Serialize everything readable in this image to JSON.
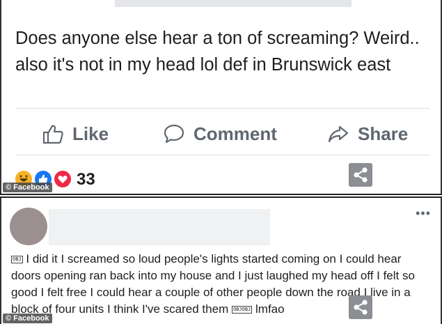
{
  "post": {
    "text": "Does anyone else hear a ton of screaming? Weird.. also it's not in my head lol def in Brunswick east",
    "actions": {
      "like": "Like",
      "comment": "Comment",
      "share": "Share"
    },
    "reaction_count": "33",
    "reaction_icons": [
      "haha-icon",
      "like-icon",
      "love-icon"
    ]
  },
  "watermark": "© Facebook",
  "reply": {
    "menu_label": "•••",
    "text_prefix_glyph": "OBJ",
    "text": "I did it I screamed so loud people's lights started coming on I could hear doors opening ran back into my house and I just laughed my head off I felt so good I felt free I could hear a couple of other people down the road I live in a block of four units I think I've scared them",
    "text_glyphs": "OBJOBJ",
    "text_suffix": "lmfao"
  },
  "colors": {
    "blue": "#1877f2",
    "love": "#f02849",
    "haha": "#f7b125",
    "grey_text": "#606770",
    "share_box": "#8b8f94"
  }
}
